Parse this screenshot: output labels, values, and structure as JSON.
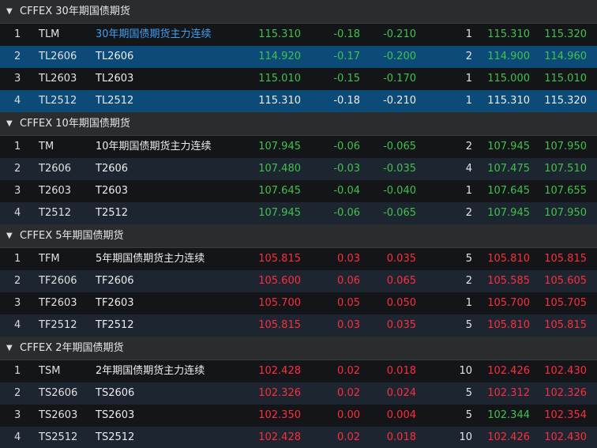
{
  "colors": {
    "up": "#ff2d3b",
    "down": "#3fc24a",
    "neutral": "#ececec",
    "link": "#3ea0f2",
    "selected_row": "#0c4b78",
    "group_header_bg": "#2b2c2e",
    "row_bg": "#141518",
    "row_alt_bg": "#1d2530"
  },
  "icons": {
    "expand": "caret-down-icon"
  },
  "groups": [
    {
      "caret": "▼",
      "title": "CFFEX 30年期国债期货",
      "rows": [
        {
          "idx": "1",
          "code": "TLM",
          "name": "30年期国债期货主力连续",
          "price": "115.310",
          "change": "-0.18",
          "change_pct": "-0.210",
          "volume": "1",
          "bid": "115.310",
          "ask": "115.320",
          "price_color": "green",
          "change_color": "green",
          "bid_color": "green",
          "ask_color": "green",
          "name_color": "blue",
          "row_style": "normal"
        },
        {
          "idx": "2",
          "code": "TL2606",
          "name": "TL2606",
          "price": "114.920",
          "change": "-0.17",
          "change_pct": "-0.200",
          "volume": "2",
          "bid": "114.900",
          "ask": "114.960",
          "price_color": "green",
          "change_color": "green",
          "bid_color": "green",
          "ask_color": "green",
          "name_color": "white",
          "row_style": "selected"
        },
        {
          "idx": "3",
          "code": "TL2603",
          "name": "TL2603",
          "price": "115.010",
          "change": "-0.15",
          "change_pct": "-0.170",
          "volume": "1",
          "bid": "115.000",
          "ask": "115.010",
          "price_color": "green",
          "change_color": "green",
          "bid_color": "green",
          "ask_color": "green",
          "name_color": "white",
          "row_style": "normal"
        },
        {
          "idx": "4",
          "code": "TL2512",
          "name": "TL2512",
          "price": "115.310",
          "change": "-0.18",
          "change_pct": "-0.210",
          "volume": "1",
          "bid": "115.310",
          "ask": "115.320",
          "price_color": "white",
          "change_color": "white",
          "bid_color": "white",
          "ask_color": "white",
          "name_color": "white",
          "row_style": "selected"
        }
      ]
    },
    {
      "caret": "▼",
      "title": "CFFEX 10年期国债期货",
      "rows": [
        {
          "idx": "1",
          "code": "TM",
          "name": "10年期国债期货主力连续",
          "price": "107.945",
          "change": "-0.06",
          "change_pct": "-0.065",
          "volume": "2",
          "bid": "107.945",
          "ask": "107.950",
          "price_color": "green",
          "change_color": "green",
          "bid_color": "green",
          "ask_color": "green",
          "name_color": "white",
          "row_style": "normal"
        },
        {
          "idx": "2",
          "code": "T2606",
          "name": "T2606",
          "price": "107.480",
          "change": "-0.03",
          "change_pct": "-0.035",
          "volume": "4",
          "bid": "107.475",
          "ask": "107.510",
          "price_color": "green",
          "change_color": "green",
          "bid_color": "green",
          "ask_color": "green",
          "name_color": "white",
          "row_style": "alt"
        },
        {
          "idx": "3",
          "code": "T2603",
          "name": "T2603",
          "price": "107.645",
          "change": "-0.04",
          "change_pct": "-0.040",
          "volume": "1",
          "bid": "107.645",
          "ask": "107.655",
          "price_color": "green",
          "change_color": "green",
          "bid_color": "green",
          "ask_color": "green",
          "name_color": "white",
          "row_style": "normal"
        },
        {
          "idx": "4",
          "code": "T2512",
          "name": "T2512",
          "price": "107.945",
          "change": "-0.06",
          "change_pct": "-0.065",
          "volume": "2",
          "bid": "107.945",
          "ask": "107.950",
          "price_color": "green",
          "change_color": "green",
          "bid_color": "green",
          "ask_color": "green",
          "name_color": "white",
          "row_style": "alt"
        }
      ]
    },
    {
      "caret": "▼",
      "title": "CFFEX 5年期国债期货",
      "rows": [
        {
          "idx": "1",
          "code": "TFM",
          "name": "5年期国债期货主力连续",
          "price": "105.815",
          "change": "0.03",
          "change_pct": "0.035",
          "volume": "5",
          "bid": "105.810",
          "ask": "105.815",
          "price_color": "red",
          "change_color": "red",
          "bid_color": "red",
          "ask_color": "red",
          "name_color": "white",
          "row_style": "normal"
        },
        {
          "idx": "2",
          "code": "TF2606",
          "name": "TF2606",
          "price": "105.600",
          "change": "0.06",
          "change_pct": "0.065",
          "volume": "2",
          "bid": "105.585",
          "ask": "105.605",
          "price_color": "red",
          "change_color": "red",
          "bid_color": "red",
          "ask_color": "red",
          "name_color": "white",
          "row_style": "alt"
        },
        {
          "idx": "3",
          "code": "TF2603",
          "name": "TF2603",
          "price": "105.700",
          "change": "0.05",
          "change_pct": "0.050",
          "volume": "1",
          "bid": "105.700",
          "ask": "105.705",
          "price_color": "red",
          "change_color": "red",
          "bid_color": "red",
          "ask_color": "red",
          "name_color": "white",
          "row_style": "normal"
        },
        {
          "idx": "4",
          "code": "TF2512",
          "name": "TF2512",
          "price": "105.815",
          "change": "0.03",
          "change_pct": "0.035",
          "volume": "5",
          "bid": "105.810",
          "ask": "105.815",
          "price_color": "red",
          "change_color": "red",
          "bid_color": "red",
          "ask_color": "red",
          "name_color": "white",
          "row_style": "alt"
        }
      ]
    },
    {
      "caret": "▼",
      "title": "CFFEX 2年期国债期货",
      "rows": [
        {
          "idx": "1",
          "code": "TSM",
          "name": "2年期国债期货主力连续",
          "price": "102.428",
          "change": "0.02",
          "change_pct": "0.018",
          "volume": "10",
          "bid": "102.426",
          "ask": "102.430",
          "price_color": "red",
          "change_color": "red",
          "bid_color": "red",
          "ask_color": "red",
          "name_color": "white",
          "row_style": "normal"
        },
        {
          "idx": "2",
          "code": "TS2606",
          "name": "TS2606",
          "price": "102.326",
          "change": "0.02",
          "change_pct": "0.024",
          "volume": "5",
          "bid": "102.312",
          "ask": "102.326",
          "price_color": "red",
          "change_color": "red",
          "bid_color": "red",
          "ask_color": "red",
          "name_color": "white",
          "row_style": "alt"
        },
        {
          "idx": "3",
          "code": "TS2603",
          "name": "TS2603",
          "price": "102.350",
          "change": "0.00",
          "change_pct": "0.004",
          "volume": "5",
          "bid": "102.344",
          "ask": "102.354",
          "price_color": "red",
          "change_color": "red",
          "bid_color": "green",
          "ask_color": "red",
          "name_color": "white",
          "row_style": "normal"
        },
        {
          "idx": "4",
          "code": "TS2512",
          "name": "TS2512",
          "price": "102.428",
          "change": "0.02",
          "change_pct": "0.018",
          "volume": "10",
          "bid": "102.426",
          "ask": "102.430",
          "price_color": "red",
          "change_color": "red",
          "bid_color": "red",
          "ask_color": "red",
          "name_color": "white",
          "row_style": "alt"
        }
      ]
    }
  ]
}
